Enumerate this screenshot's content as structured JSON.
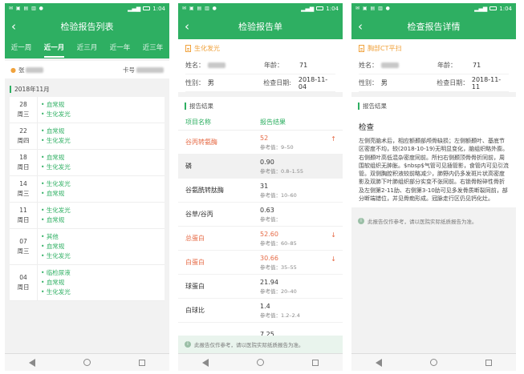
{
  "status": {
    "left_icons": "✉ ▣ ▤ ▥ ●",
    "time": "1:04"
  },
  "screen1": {
    "title": "检验报告列表",
    "tabs": [
      "近一周",
      "近一月",
      "近三月",
      "近一年",
      "近三年"
    ],
    "user_label": "张",
    "card_label": "卡号",
    "month": "2018年11月",
    "days": [
      {
        "date": "28",
        "weekday": "周三",
        "items": [
          "血常规",
          "生化发光"
        ]
      },
      {
        "date": "22",
        "weekday": "周四",
        "items": [
          "血常规",
          "生化发光"
        ]
      },
      {
        "date": "18",
        "weekday": "周日",
        "items": [
          "血常规",
          "生化发光"
        ]
      },
      {
        "date": "14",
        "weekday": "周三",
        "items": [
          "生化发光",
          "血常规"
        ]
      },
      {
        "date": "11",
        "weekday": "周日",
        "items": [
          "生化发光",
          "血常规"
        ]
      },
      {
        "date": "07",
        "weekday": "周三",
        "items": [
          "其他",
          "血常规",
          "生化发光"
        ]
      },
      {
        "date": "04",
        "weekday": "周日",
        "items": [
          "临检尿液",
          "血常规",
          "生化发光"
        ]
      }
    ]
  },
  "screen2": {
    "title": "检验报告单",
    "report_name": "生化发光",
    "name_label": "姓名：",
    "age_label": "年龄：",
    "age": "71",
    "sex_label": "性别：",
    "sex": "男",
    "date_label": "检查日期:",
    "date": "2018-11-04",
    "section": "报告结果",
    "col_item": "项目名称",
    "col_result": "报告结果",
    "results": [
      {
        "name": "谷丙转氨酶",
        "value": "52",
        "ref": "参考值：9–50",
        "abnormal": true,
        "arrow": "↑"
      },
      {
        "name": "磷",
        "value": "0.90",
        "ref": "参考值：0.8–1.55",
        "abnormal": false,
        "arrow": ""
      },
      {
        "name": "谷氨酰转肽酶",
        "value": "31",
        "ref": "参考值：10–60",
        "abnormal": false,
        "arrow": ""
      },
      {
        "name": "谷草/谷丙",
        "value": "0.63",
        "ref": "参考值：",
        "abnormal": false,
        "arrow": ""
      },
      {
        "name": "总蛋白",
        "value": "52.60",
        "ref": "参考值：60–85",
        "abnormal": true,
        "arrow": "↓"
      },
      {
        "name": "白蛋白",
        "value": "30.66",
        "ref": "参考值：35–55",
        "abnormal": true,
        "arrow": "↓"
      },
      {
        "name": "球蛋白",
        "value": "21.94",
        "ref": "参考值：20–40",
        "abnormal": false,
        "arrow": ""
      },
      {
        "name": "白球比",
        "value": "1.4",
        "ref": "参考值：1.2–2.4",
        "abnormal": false,
        "arrow": ""
      },
      {
        "name": "",
        "value": "7.25",
        "ref": "",
        "abnormal": false,
        "arrow": ""
      }
    ],
    "disclaimer": "此报告仅作参考，请以医院实际纸质报告为准。"
  },
  "screen3": {
    "title": "检查报告详情",
    "report_name": "胸部CT平扫",
    "name_label": "姓名：",
    "age_label": "年龄：",
    "age": "71",
    "sex_label": "性别：",
    "sex": "男",
    "date_label": "检查日期：",
    "date": "2018-11-11",
    "section": "报告结果",
    "heading": "检查",
    "body": "左侧亮脑术后，相应额颞部颅骨缺损；左侧额颞叶、基底节区密度不均，较(2018-10-19)无明显变化，脑组织略外膨。右侧颞叶高低混杂密度同前。所扫右侧颞顶骨骨折同前，周围软组织无肿胀。$nbsp$气管可见插管影，食管内可见引流管。双侧胸腔积液较前略减少，肺野内仍多发斑片状高密度影及双肺下叶肺组织部分实变不张同前。右锁骨粉碎性骨折及左侧第2-11肋、右侧第3-10肋可见多发骨质断裂同前，部分断端错位，并见骨痂形成。冠脉走行区仍见钙化灶。",
    "disclaimer": "此报告仅作参考，请以医院实际纸质报告为准。"
  }
}
